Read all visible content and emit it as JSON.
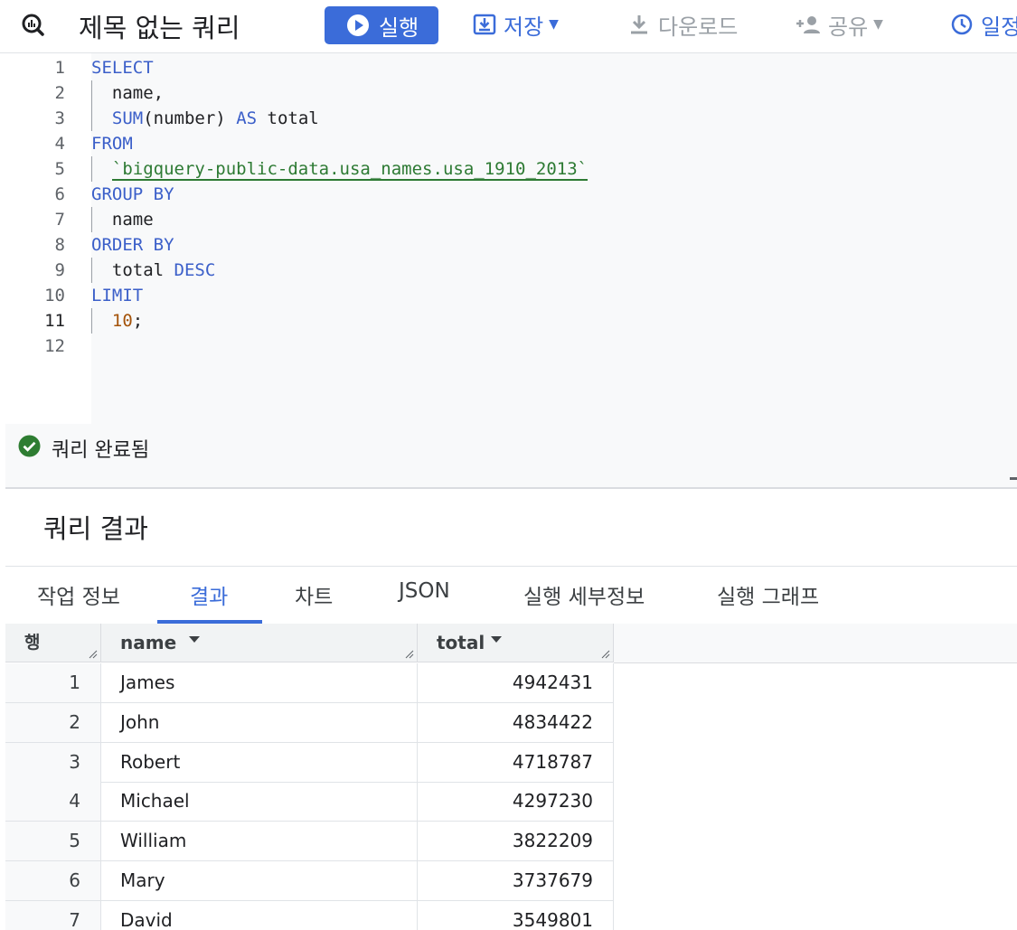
{
  "toolbar": {
    "title": "제목 없는 쿼리",
    "run_label": "실행",
    "save_label": "저장",
    "download_label": "다운로드",
    "share_label": "공유",
    "schedule_label": "일정"
  },
  "editor": {
    "line_numbers": [
      "1",
      "2",
      "3",
      "4",
      "5",
      "6",
      "7",
      "8",
      "9",
      "10",
      "11",
      "12"
    ],
    "active_line": "11",
    "tokens": {
      "select": "SELECT",
      "name_col": "name,",
      "sum": "SUM",
      "sum_arg": "(number)",
      "as": "AS",
      "total_alias": "total",
      "from": "FROM",
      "table": "`bigquery-public-data.usa_names.usa_1910_2013`",
      "group_by": "GROUP BY",
      "group_col": "name",
      "order_by": "ORDER BY",
      "order_col": "total",
      "desc": "DESC",
      "limit": "LIMIT",
      "limit_value": "10",
      "semicolon": ";"
    }
  },
  "status": {
    "text": "쿼리 완료됨"
  },
  "results": {
    "title": "쿼리 결과",
    "tabs": [
      "작업 정보",
      "결과",
      "차트",
      "JSON",
      "실행 세부정보",
      "실행 그래프"
    ],
    "active_tab": "결과",
    "columns": {
      "row": "행",
      "name": "name",
      "total": "total"
    },
    "rows": [
      {
        "idx": "1",
        "name": "James",
        "total": "4942431"
      },
      {
        "idx": "2",
        "name": "John",
        "total": "4834422"
      },
      {
        "idx": "3",
        "name": "Robert",
        "total": "4718787"
      },
      {
        "idx": "4",
        "name": "Michael",
        "total": "4297230"
      },
      {
        "idx": "5",
        "name": "William",
        "total": "3822209"
      },
      {
        "idx": "6",
        "name": "Mary",
        "total": "3737679"
      },
      {
        "idx": "7",
        "name": "David",
        "total": "3549801"
      }
    ]
  },
  "colors": {
    "accent": "#3b6cd9",
    "success": "#2e7d32",
    "keyword": "#3b5fc9",
    "string": "#2d7a33",
    "number": "#a4530a"
  }
}
